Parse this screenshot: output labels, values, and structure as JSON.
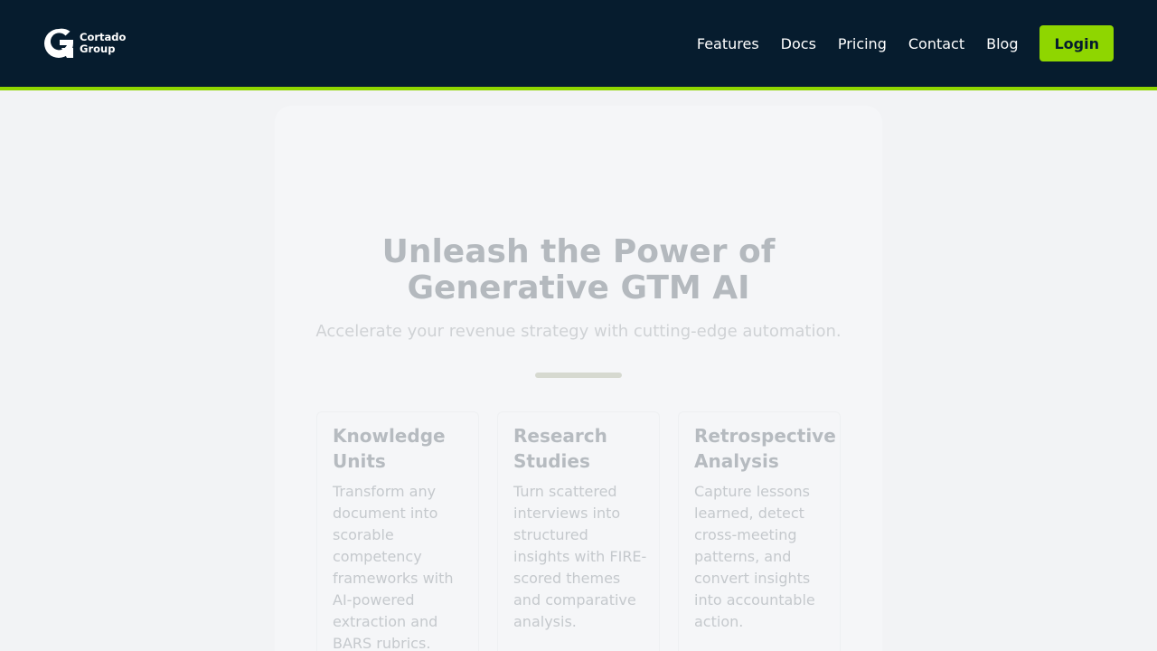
{
  "brand": {
    "line1": "Cortado",
    "line2": "Group",
    "accent_color": "#8fd600",
    "header_bg": "#061c2e"
  },
  "nav": {
    "items": [
      "Features",
      "Docs",
      "Pricing",
      "Contact",
      "Blog"
    ],
    "login_label": "Login"
  },
  "hero": {
    "title_line1": "Unleash the Power of",
    "title_line2": "Generative GTM AI",
    "subtitle": "Accelerate your revenue strategy with cutting-edge automation."
  },
  "features": [
    {
      "title": "Knowledge Units",
      "description": "Transform any document into scorable competency frameworks with AI-powered extraction and BARS rubrics."
    },
    {
      "title": "Research Studies",
      "description": "Turn scattered interviews into structured insights with FIRE-scored themes and comparative analysis."
    },
    {
      "title": "Retrospective Analysis",
      "description": "Capture lessons learned, detect cross-meeting patterns, and convert insights into accountable action."
    }
  ]
}
